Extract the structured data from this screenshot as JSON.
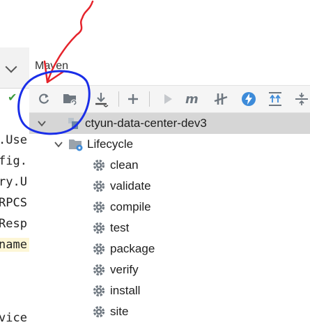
{
  "editor": {
    "lines": [
      ".Use",
      "fig.",
      "ry.U",
      "RPCS",
      "Resp",
      "name",
      "vice"
    ]
  },
  "maven": {
    "title": "Maven",
    "toolbar": {
      "reload": "reload-icon",
      "generate": "folder-sync-icon",
      "download": "download-icon",
      "add": "plus-icon",
      "run": "run-icon",
      "execute": "m-icon",
      "skip_tests": "toggle-offline-icon",
      "lightning": "lightning-icon",
      "show_deps": "dependencies-icon",
      "collapse": "collapse-icon"
    },
    "project": "ctyun-data-center-dev3",
    "lifecycle_label": "Lifecycle",
    "goals": [
      "clean",
      "validate",
      "compile",
      "test",
      "package",
      "verify",
      "install",
      "site"
    ]
  },
  "colors": {
    "annotation_red": "#e5232b",
    "annotation_blue": "#1a2ee8",
    "selection": "#d6d6d6",
    "gear": "#6e7780",
    "accent_blue": "#3d8bd9"
  }
}
